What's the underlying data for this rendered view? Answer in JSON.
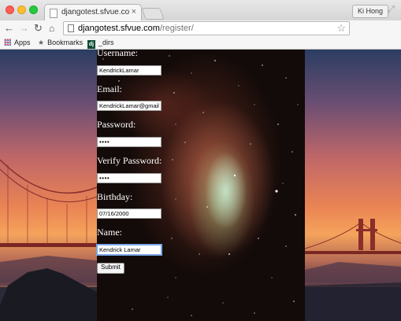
{
  "window": {
    "profile_name": "Ki Hong"
  },
  "tab": {
    "title": "djangotest.sfvue.com/register/",
    "close": "×"
  },
  "toolbar": {
    "url_host": "djangotest.sfvue.com",
    "url_path": "/register/"
  },
  "bookmarks": {
    "items": [
      {
        "label": "Apps",
        "icon": "apps-grid-icon"
      },
      {
        "label": "Bookmarks",
        "icon": "star-icon"
      },
      {
        "label": "_dirs",
        "icon": "django-icon",
        "icon_text": "dj"
      }
    ]
  },
  "form": {
    "username_label": "Username:",
    "username_value": "KendrickLamar",
    "email_label": "Email:",
    "email_value": "KendrickLamar@gmail",
    "password_label": "Password:",
    "password_value": "••••",
    "verify_label": "Verify Password:",
    "verify_value": "••••",
    "birthday_label": "Birthday:",
    "birthday_value": "07/16/2000",
    "name_label": "Name:",
    "name_value": "Kendrick Lamar",
    "submit_label": "Submit"
  },
  "colors": {
    "focus_ring": "#7aa7e8",
    "bridge_red": "#b8322a",
    "sunset_orange": "#ea8454"
  }
}
